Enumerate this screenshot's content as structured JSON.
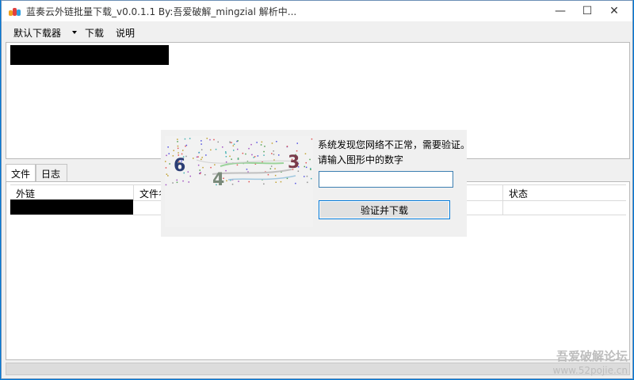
{
  "window": {
    "title": "蓝奏云外链批量下载_v0.0.1.1 By:吾爱破解_mingzial 解析中...",
    "controls": {
      "minimize": "—",
      "maximize": "☐",
      "close": "✕"
    }
  },
  "menu": {
    "downloader_select": "默认下载器",
    "download": "下载",
    "help": "说明"
  },
  "tabs": [
    {
      "label": "文件",
      "active": true
    },
    {
      "label": "日志",
      "active": false
    }
  ],
  "grid": {
    "columns": [
      "外链",
      "文件名",
      "状态"
    ]
  },
  "dialog": {
    "message_line1": "系统发现您网络不正常，需要验证。",
    "message_line2": "请输入图形中的数字",
    "input_value": "",
    "verify_button": "验证并下载",
    "captcha_digits": [
      "6",
      "4",
      "3"
    ]
  },
  "watermark": {
    "line1": "吾爱破解论坛",
    "line2": "www.52pojie.cn"
  },
  "colors": {
    "accent": "#0078d7",
    "captcha_digit_1": "#2c3e75",
    "captcha_digit_2": "#7a8a7a",
    "captcha_digit_3": "#7a3a4a"
  }
}
